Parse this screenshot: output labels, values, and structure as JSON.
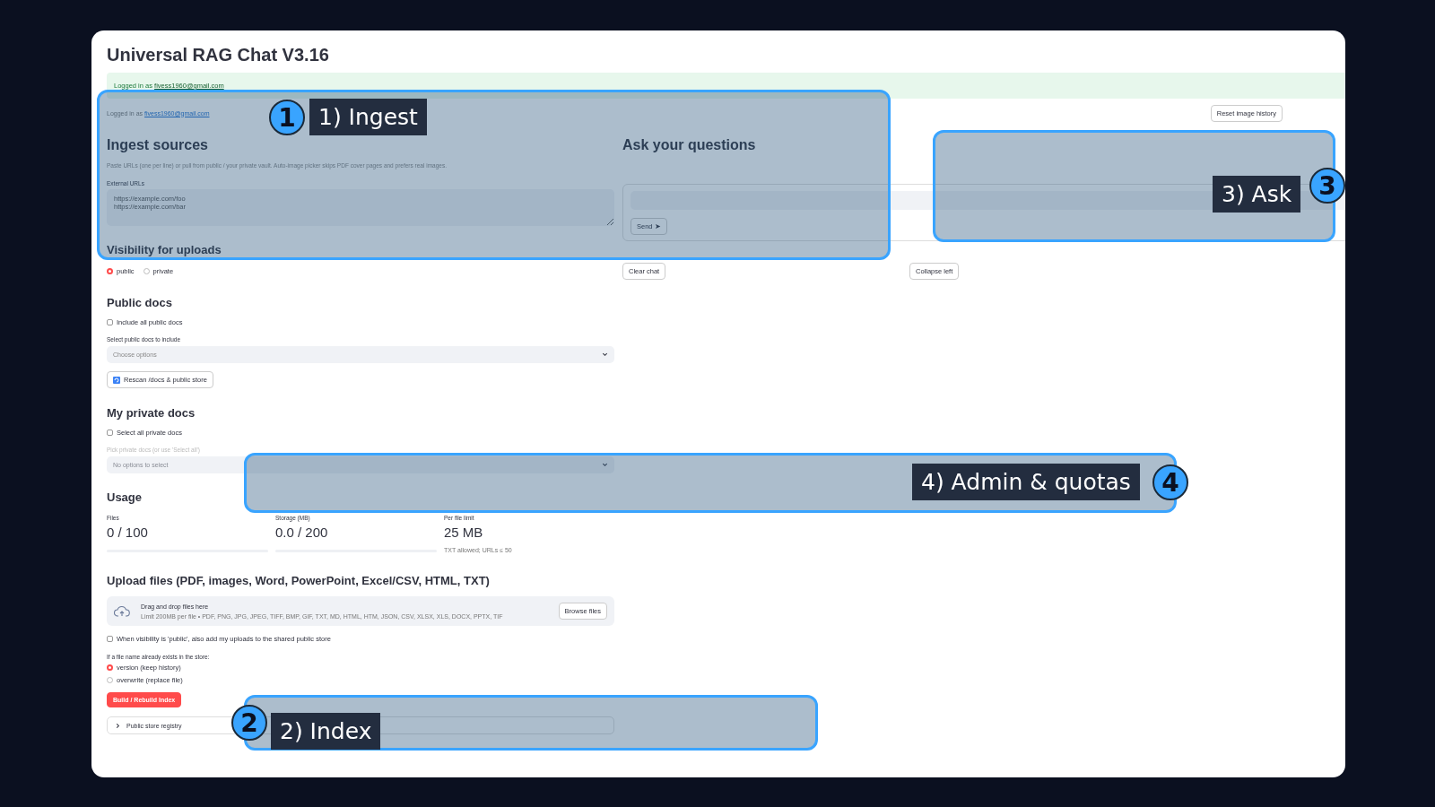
{
  "title": "Universal RAG Chat V3.16",
  "banner": {
    "prefix": "Logged in as",
    "email": "fivess1960@gmail.com"
  },
  "login_line": {
    "prefix": "Logged in as",
    "email": "fivess1960@gmail.com"
  },
  "reset_button": "Reset image history",
  "ingest": {
    "heading": "Ingest sources",
    "description": "Paste URLs (one per line) or pull from public / your private vault. Auto-image picker skips PDF cover pages and prefers real images.",
    "urls_label": "External URLs",
    "urls_placeholder": "https://example.com/foo\nhttps://example.com/bar"
  },
  "visibility": {
    "heading": "Visibility for uploads",
    "options": [
      {
        "label": "public",
        "selected": true
      },
      {
        "label": "private",
        "selected": false
      }
    ]
  },
  "public_docs": {
    "heading": "Public docs",
    "checkbox": {
      "label": "Include all public docs",
      "checked": false
    },
    "select": {
      "label": "Select public docs to include",
      "placeholder": "Choose options",
      "disabled": false
    },
    "rescan_button": "Rescan /docs & public store"
  },
  "private_docs": {
    "heading": "My private docs",
    "checkbox": {
      "label": "Select all private docs",
      "checked": false
    },
    "select": {
      "label": "Pick private docs (or use 'Select all')",
      "placeholder": "No options to select",
      "disabled": true
    }
  },
  "usage": {
    "heading": "Usage",
    "metrics": [
      {
        "kind": "bar",
        "label": "Files",
        "value": "0 / 100",
        "level": 0
      },
      {
        "kind": "bar",
        "label": "Storage (MB)",
        "value": "0.0 / 200",
        "level": 0
      },
      {
        "kind": "caption",
        "label": "Per file limit",
        "value": "25 MB",
        "caption": "TXT allowed; URLs ≤ 50"
      }
    ]
  },
  "upload": {
    "heading": "Upload files (PDF, images, Word, PowerPoint, Excel/CSV, HTML, TXT)",
    "dropzone": {
      "title": "Drag and drop files here",
      "hint": "Limit 200MB per file • PDF, PNG, JPG, JPEG, TIFF, BMP, GIF, TXT, MD, HTML, HTM, JSON, CSV, XLSX, XLS, DOCX, PPTX, TIF",
      "button": "Browse files"
    },
    "share_checkbox": {
      "label": "When visibility is 'public', also add my uploads to the shared public store",
      "checked": false
    },
    "conflict": {
      "label": "If a file name already exists in the store:",
      "options": [
        {
          "label": "version (keep history)",
          "selected": true
        },
        {
          "label": "overwrite (replace file)",
          "selected": false
        }
      ]
    },
    "build_button": "Build / Rebuild Index",
    "registry": {
      "label": "Public store registry",
      "expanded": false
    }
  },
  "chat": {
    "heading": "Ask your questions",
    "send_button": "Send ➤",
    "clear_button": "Clear chat",
    "collapse_button": "Collapse left"
  },
  "callouts": [
    {
      "number": "1",
      "label": "1) Ingest"
    },
    {
      "number": "2",
      "label": "2) Index"
    },
    {
      "number": "3",
      "label": "3) Ask"
    },
    {
      "number": "4",
      "label": "4) Admin & quotas"
    }
  ]
}
